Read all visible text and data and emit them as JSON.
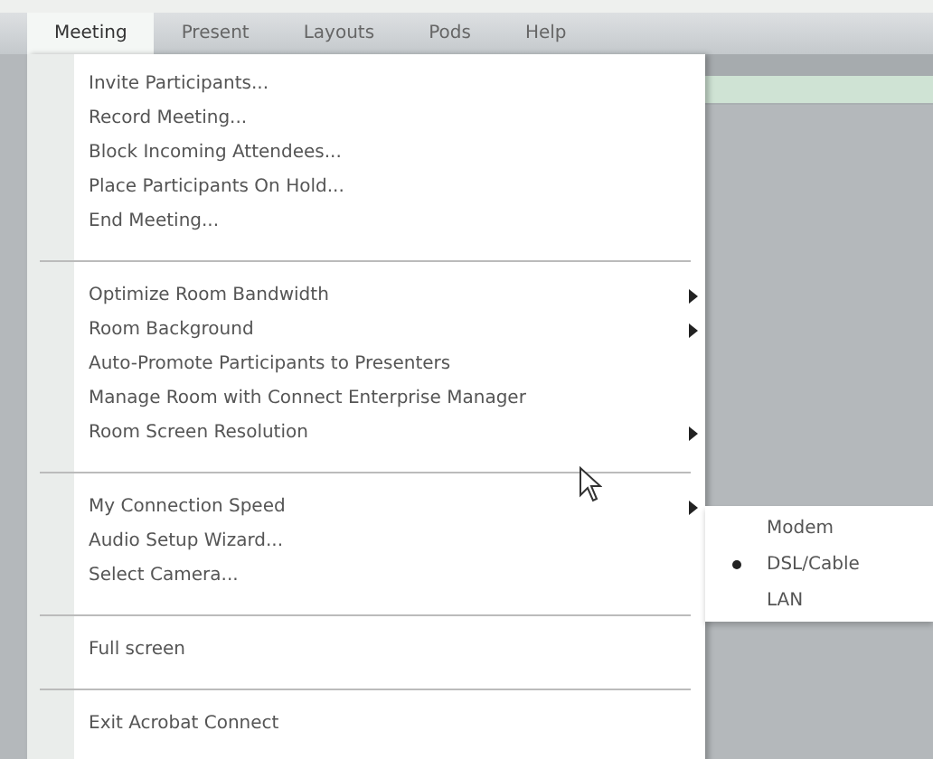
{
  "menubar": [
    {
      "label": "Meeting",
      "selected": true
    },
    {
      "label": "Present",
      "selected": false
    },
    {
      "label": "Layouts",
      "selected": false
    },
    {
      "label": "Pods",
      "selected": false
    },
    {
      "label": "Help",
      "selected": false
    }
  ],
  "menu": {
    "groups": [
      {
        "items": [
          {
            "label": "Invite Participants...",
            "kind": "item"
          },
          {
            "label": "Record Meeting...",
            "kind": "item"
          },
          {
            "label": "Block Incoming Attendees...",
            "kind": "item"
          },
          {
            "label": "Place Participants On Hold...",
            "kind": "item"
          },
          {
            "label": "End Meeting...",
            "kind": "item"
          }
        ]
      },
      {
        "items": [
          {
            "label": "Optimize Room Bandwidth",
            "kind": "submenu"
          },
          {
            "label": "Room Background",
            "kind": "submenu"
          },
          {
            "label": "Auto-Promote Participants to Presenters",
            "kind": "item"
          },
          {
            "label": "Manage Room with Connect Enterprise Manager",
            "kind": "item"
          },
          {
            "label": "Room Screen Resolution",
            "kind": "submenu"
          }
        ]
      },
      {
        "items": [
          {
            "label": "My Connection Speed",
            "kind": "submenu"
          },
          {
            "label": "Audio Setup Wizard...",
            "kind": "item"
          },
          {
            "label": "Select Camera...",
            "kind": "item"
          }
        ]
      },
      {
        "items": [
          {
            "label": "Full screen",
            "kind": "item"
          }
        ]
      },
      {
        "items": [
          {
            "label": "Exit Acrobat Connect",
            "kind": "item"
          }
        ]
      }
    ]
  },
  "submenu": {
    "items": [
      {
        "label": "Modem",
        "selected": false
      },
      {
        "label": "DSL/Cable",
        "selected": true
      },
      {
        "label": "LAN",
        "selected": false
      }
    ]
  }
}
